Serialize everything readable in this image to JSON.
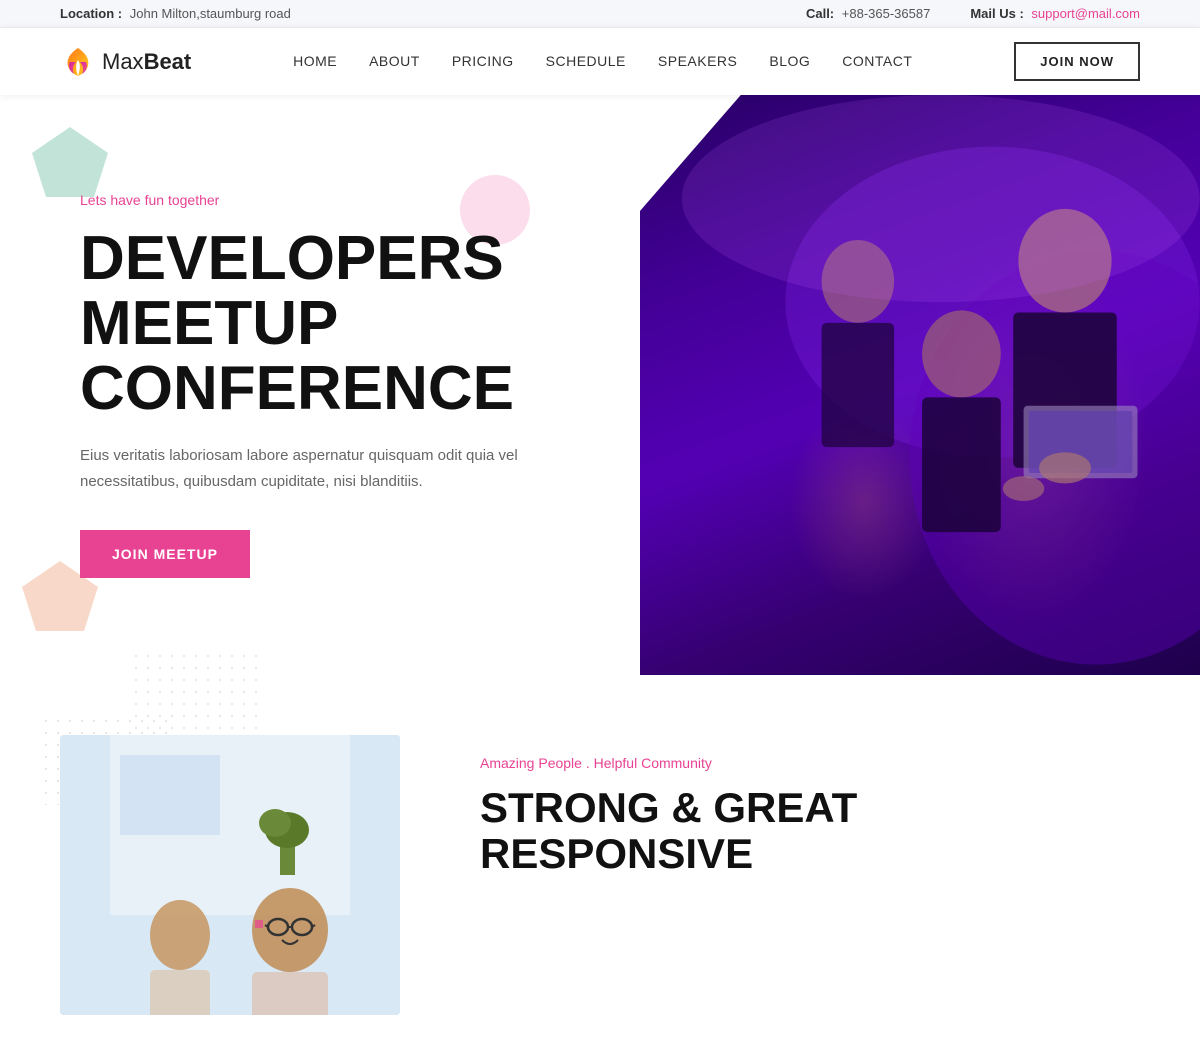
{
  "topbar": {
    "location_label": "Location :",
    "location_value": "John Milton,staumburg road",
    "call_label": "Call:",
    "call_value": "+88-365-36587",
    "mail_label": "Mail Us :",
    "mail_value": "support@mail.com"
  },
  "navbar": {
    "logo_text_light": "Max",
    "logo_text_bold": "Beat",
    "nav_items": [
      {
        "label": "HOME",
        "id": "home"
      },
      {
        "label": "ABOUT",
        "id": "about"
      },
      {
        "label": "PRICING",
        "id": "pricing"
      },
      {
        "label": "SCHEDULE",
        "id": "schedule"
      },
      {
        "label": "SPEAKERS",
        "id": "speakers"
      },
      {
        "label": "BLOG",
        "id": "blog"
      },
      {
        "label": "CONTACT",
        "id": "contact"
      }
    ],
    "join_btn": "JOIN NOW"
  },
  "hero": {
    "tagline": "Lets have fun together",
    "title_line1": "DEVELOPERS MEETUP",
    "title_line2": "CONFERENCE",
    "description": "Eius veritatis laboriosam labore aspernatur quisquam odit quia vel necessitatibus, quibusdam cupiditate, nisi blanditiis.",
    "cta_btn": "JOIN MEETUP"
  },
  "about": {
    "tagline": "Amazing People . Helpful Community",
    "title_line1": "STRONG & GREAT",
    "title_line2": "RESPONSIVE"
  },
  "colors": {
    "accent": "#e84393",
    "dark": "#111111",
    "teal_shape": "#a8d8c8",
    "peach_shape": "#f5c8b0"
  }
}
